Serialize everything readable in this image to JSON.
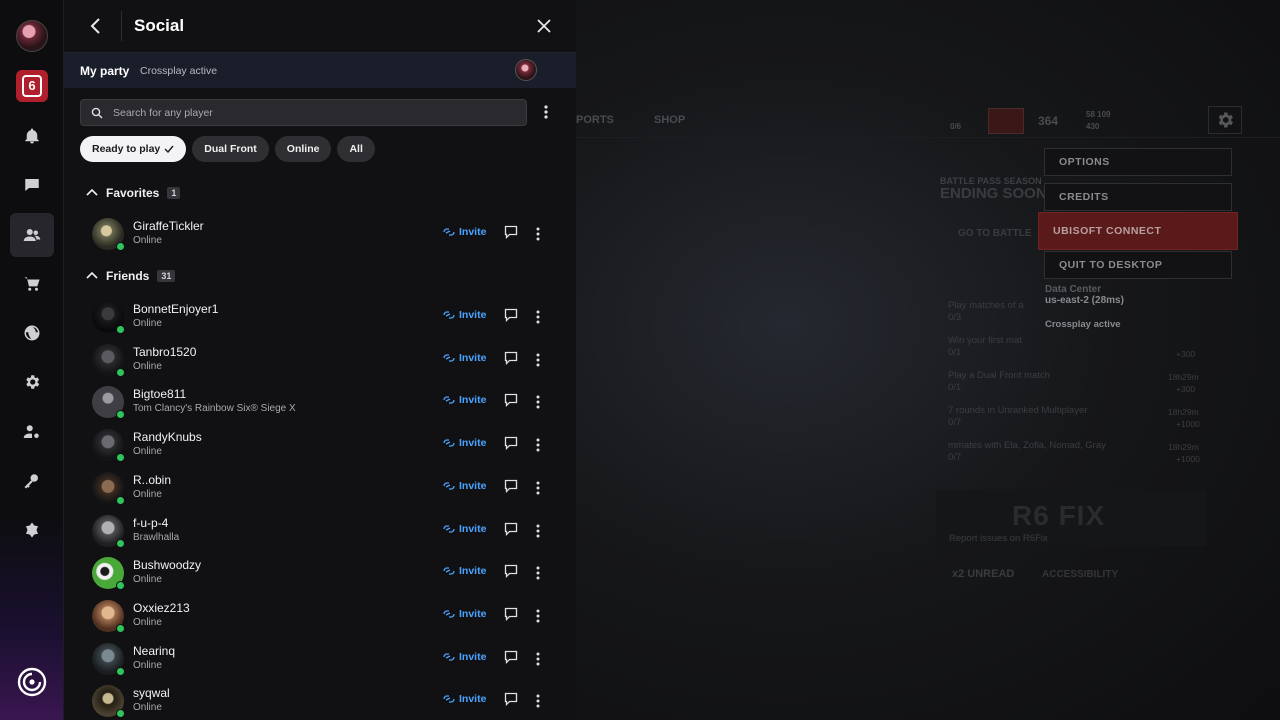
{
  "colors": {
    "accent_invite": "#4aa3ff",
    "online": "#2fc55a",
    "highlight_menu": "#5a1a1a"
  },
  "panel": {
    "title": "Social",
    "party": {
      "label": "My party",
      "status": "Crossplay active"
    },
    "search": {
      "placeholder": "Search for any player"
    },
    "filters": [
      "Ready to play",
      "Dual Front",
      "Online",
      "All"
    ],
    "invite_label": "Invite",
    "favorites": {
      "title": "Favorites",
      "count": "1",
      "friends": [
        {
          "name": "GiraffeTickler",
          "status": "Online"
        }
      ]
    },
    "friends": {
      "title": "Friends",
      "count": "31",
      "list": [
        {
          "name": "BonnetEnjoyer1",
          "status": "Online"
        },
        {
          "name": "Tanbro1520",
          "status": "Online"
        },
        {
          "name": "Bigtoe811",
          "status": "Tom Clancy's Rainbow Six® Siege X"
        },
        {
          "name": "RandyKnubs",
          "status": "Online"
        },
        {
          "name": "R..obin",
          "status": "Online"
        },
        {
          "name": "f-u-p-4",
          "status": "Brawlhalla"
        },
        {
          "name": "Bushwoodzy",
          "status": "Online"
        },
        {
          "name": "Oxxiez213",
          "status": "Online"
        },
        {
          "name": "Nearinq",
          "status": "Online"
        },
        {
          "name": "syqwal",
          "status": "Online"
        }
      ]
    }
  },
  "game": {
    "nav": {
      "ports": "PORTS",
      "shop": "SHOP"
    },
    "stats": {
      "level": "364",
      "renown": "58 109",
      "credits": "430",
      "squad": "0/6"
    },
    "menu": [
      "OPTIONS",
      "CREDITS",
      "UBISOFT CONNECT",
      "QUIT TO DESKTOP"
    ],
    "data_center_label": "Data Center",
    "data_center_value": "us-east-2 (28ms)",
    "crossplay": "Crossplay active",
    "battle_pass_head": "BATTLE PASS SEASON",
    "battle_pass_title": "ENDING SOON",
    "go_to_battle": "GO TO BATTLE",
    "challenges": [
      {
        "text": "Play matches of a",
        "progress": "0/3"
      },
      {
        "text": "Win your first mat",
        "progress": "0/1",
        "reward": "+300"
      },
      {
        "text": "Play a Dual Front match",
        "progress": "0/1",
        "time": "18h29m",
        "reward": "+300"
      },
      {
        "text": "7 rounds in Unranked Multiplayer",
        "progress": "0/7",
        "time": "18h29m",
        "reward": "+1000"
      },
      {
        "text": "mmates with Ela, Zofia, Nomad, Gray",
        "progress": "0/7",
        "time": "18h29m",
        "reward": "+1000"
      }
    ],
    "r6fix_logo": "R6 FIX",
    "report": "Report issues on R6Fix",
    "unread": "x2 UNREAD",
    "accessibility": "ACCESSIBILITY"
  }
}
